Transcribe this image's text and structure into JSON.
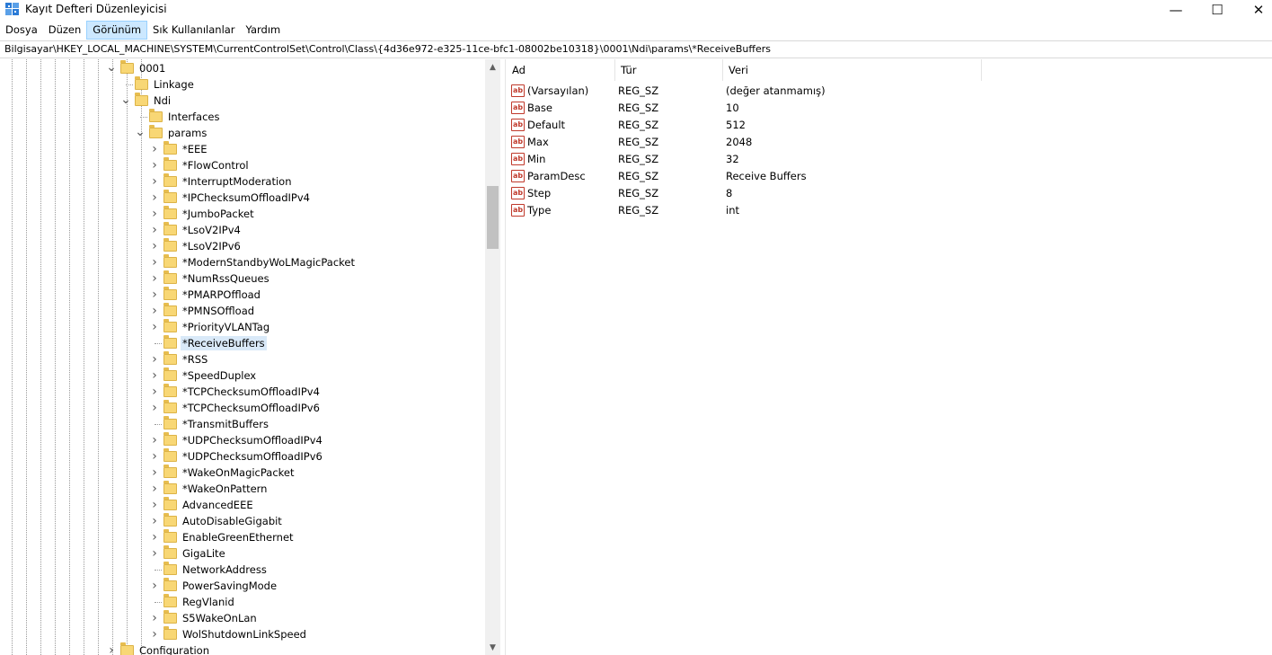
{
  "window": {
    "title": "Kayıt Defteri Düzenleyicisi",
    "minimize": "—",
    "maximize": "☐",
    "close": "✕"
  },
  "menu": [
    "Dosya",
    "Düzen",
    "Görünüm",
    "Sık Kullanılanlar",
    "Yardım"
  ],
  "address": "Bilgisayar\\HKEY_LOCAL_MACHINE\\SYSTEM\\CurrentControlSet\\Control\\Class\\{4d36e972-e325-11ce-bfc1-08002be10318}\\0001\\Ndi\\params\\*ReceiveBuffers",
  "tree": [
    {
      "label": "0001",
      "level": 0,
      "expander": "v"
    },
    {
      "label": "Linkage",
      "level": 1,
      "expander": ""
    },
    {
      "label": "Ndi",
      "level": 1,
      "expander": "v"
    },
    {
      "label": "Interfaces",
      "level": 2,
      "expander": ""
    },
    {
      "label": "params",
      "level": 2,
      "expander": "v"
    },
    {
      "label": "*EEE",
      "level": 3,
      "expander": ">"
    },
    {
      "label": "*FlowControl",
      "level": 3,
      "expander": ">"
    },
    {
      "label": "*InterruptModeration",
      "level": 3,
      "expander": ">"
    },
    {
      "label": "*IPChecksumOffloadIPv4",
      "level": 3,
      "expander": ">"
    },
    {
      "label": "*JumboPacket",
      "level": 3,
      "expander": ">"
    },
    {
      "label": "*LsoV2IPv4",
      "level": 3,
      "expander": ">"
    },
    {
      "label": "*LsoV2IPv6",
      "level": 3,
      "expander": ">"
    },
    {
      "label": "*ModernStandbyWoLMagicPacket",
      "level": 3,
      "expander": ">"
    },
    {
      "label": "*NumRssQueues",
      "level": 3,
      "expander": ">"
    },
    {
      "label": "*PMARPOffload",
      "level": 3,
      "expander": ">"
    },
    {
      "label": "*PMNSOffload",
      "level": 3,
      "expander": ">"
    },
    {
      "label": "*PriorityVLANTag",
      "level": 3,
      "expander": ">"
    },
    {
      "label": "*ReceiveBuffers",
      "level": 3,
      "expander": "",
      "selected": true
    },
    {
      "label": "*RSS",
      "level": 3,
      "expander": ">"
    },
    {
      "label": "*SpeedDuplex",
      "level": 3,
      "expander": ">"
    },
    {
      "label": "*TCPChecksumOffloadIPv4",
      "level": 3,
      "expander": ">"
    },
    {
      "label": "*TCPChecksumOffloadIPv6",
      "level": 3,
      "expander": ">"
    },
    {
      "label": "*TransmitBuffers",
      "level": 3,
      "expander": ""
    },
    {
      "label": "*UDPChecksumOffloadIPv4",
      "level": 3,
      "expander": ">"
    },
    {
      "label": "*UDPChecksumOffloadIPv6",
      "level": 3,
      "expander": ">"
    },
    {
      "label": "*WakeOnMagicPacket",
      "level": 3,
      "expander": ">"
    },
    {
      "label": "*WakeOnPattern",
      "level": 3,
      "expander": ">"
    },
    {
      "label": "AdvancedEEE",
      "level": 3,
      "expander": ">"
    },
    {
      "label": "AutoDisableGigabit",
      "level": 3,
      "expander": ">"
    },
    {
      "label": "EnableGreenEthernet",
      "level": 3,
      "expander": ">"
    },
    {
      "label": "GigaLite",
      "level": 3,
      "expander": ">"
    },
    {
      "label": "NetworkAddress",
      "level": 3,
      "expander": ""
    },
    {
      "label": "PowerSavingMode",
      "level": 3,
      "expander": ">"
    },
    {
      "label": "RegVlanid",
      "level": 3,
      "expander": ""
    },
    {
      "label": "S5WakeOnLan",
      "level": 3,
      "expander": ">"
    },
    {
      "label": "WolShutdownLinkSpeed",
      "level": 3,
      "expander": ">"
    },
    {
      "label": "Configuration",
      "level": 0,
      "expander": ">"
    }
  ],
  "columns": {
    "name": "Ad",
    "type": "Tür",
    "data": "Veri"
  },
  "values": [
    {
      "name": "(Varsayılan)",
      "type": "REG_SZ",
      "data": "(değer atanmamış)"
    },
    {
      "name": "Base",
      "type": "REG_SZ",
      "data": "10"
    },
    {
      "name": "Default",
      "type": "REG_SZ",
      "data": "512"
    },
    {
      "name": "Max",
      "type": "REG_SZ",
      "data": "2048"
    },
    {
      "name": "Min",
      "type": "REG_SZ",
      "data": "32"
    },
    {
      "name": "ParamDesc",
      "type": "REG_SZ",
      "data": "Receive Buffers"
    },
    {
      "name": "Step",
      "type": "REG_SZ",
      "data": "8"
    },
    {
      "name": "Type",
      "type": "REG_SZ",
      "data": "int"
    }
  ],
  "icons": {
    "value": "ab"
  },
  "colors": {
    "selection": "#d9e9f8",
    "menu_active": "#cce8ff",
    "folder": "#f8d775"
  }
}
